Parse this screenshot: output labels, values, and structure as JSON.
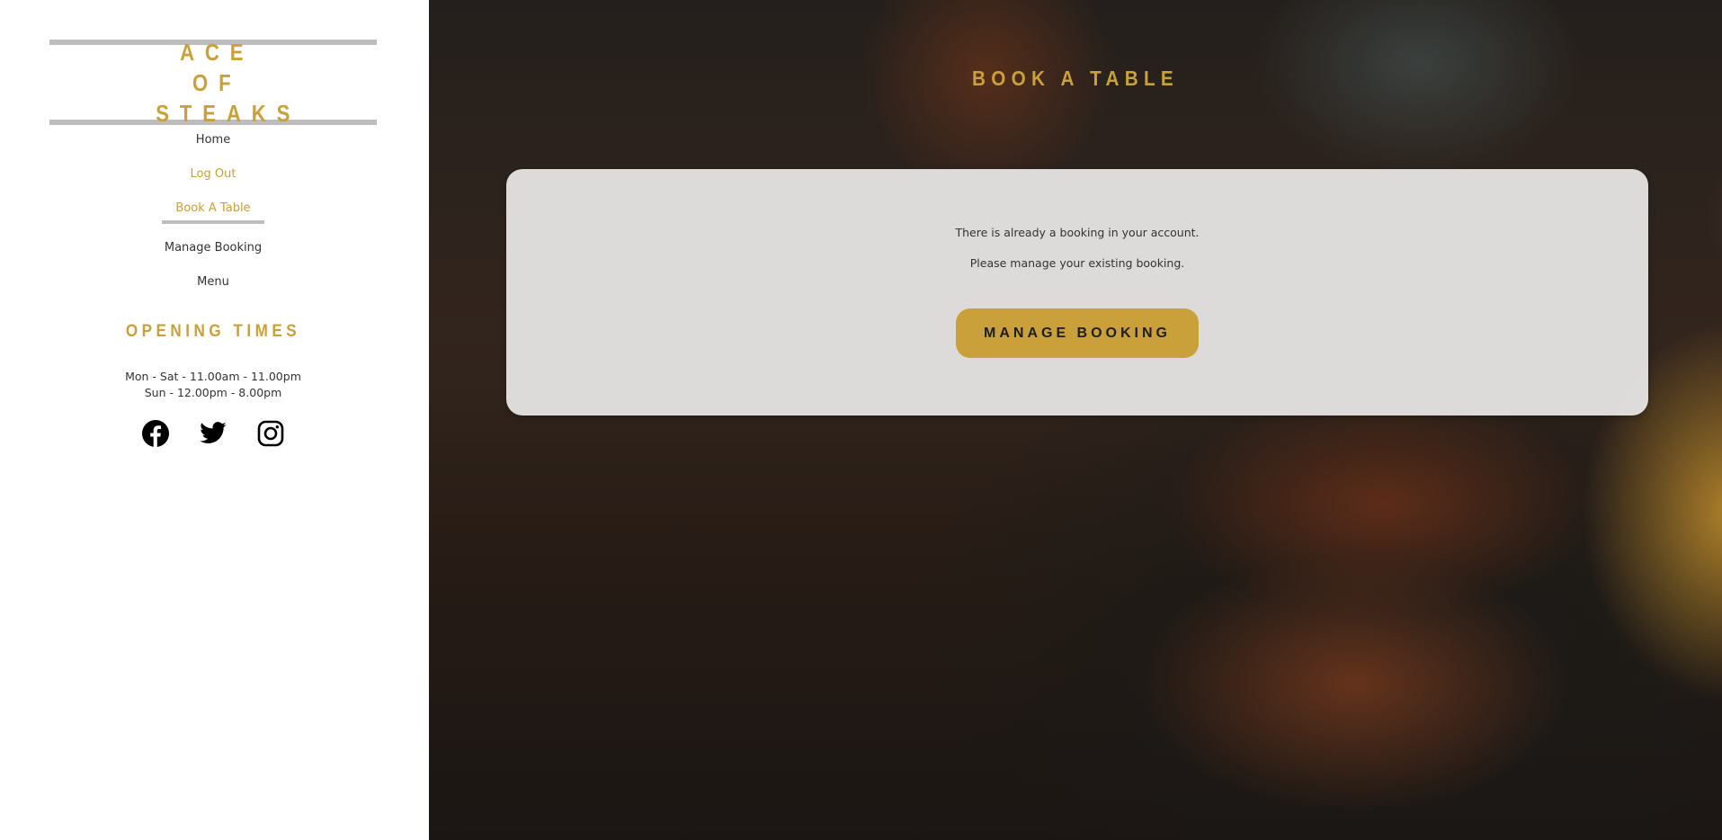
{
  "brand": {
    "name": "ACE OF STEAKS"
  },
  "nav": {
    "items": [
      {
        "label": "Home",
        "style": "normal"
      },
      {
        "label": "Log Out",
        "style": "gold"
      },
      {
        "label": "Book A Table",
        "style": "active"
      },
      {
        "label": "Manage Booking",
        "style": "normal"
      },
      {
        "label": "Menu",
        "style": "normal"
      }
    ]
  },
  "opening": {
    "title": "OPENING TIMES",
    "lines": [
      "Mon - Sat - 11.00am - 11.00pm",
      "Sun - 12.00pm - 8.00pm"
    ]
  },
  "socials": [
    "facebook-icon",
    "twitter-icon",
    "instagram-icon"
  ],
  "main": {
    "title": "BOOK A TABLE",
    "message_1": "There is already a booking in your account.",
    "message_2": "Please manage your existing booking.",
    "button_label": "MANAGE BOOKING"
  },
  "colors": {
    "accent": "#c9a03a",
    "divider": "#bdbdbd",
    "text": "#333333"
  }
}
